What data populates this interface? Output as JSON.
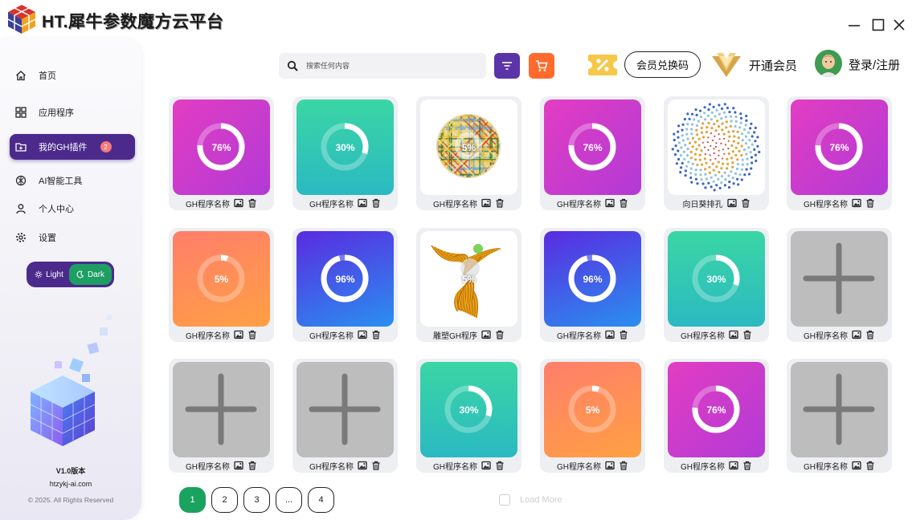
{
  "app": {
    "title": "HT.犀牛参数魔方云平台"
  },
  "sidebar": {
    "items": [
      {
        "label": "首页",
        "icon": "home-icon"
      },
      {
        "label": "应用程序",
        "icon": "apps-grid-icon"
      },
      {
        "label": "我的GH插件",
        "icon": "folder-plus-icon",
        "badge": "2"
      },
      {
        "label": "AI智能工具",
        "icon": "ai-knot-icon"
      },
      {
        "label": "个人中心",
        "icon": "user-icon"
      },
      {
        "label": "设置",
        "icon": "gear-icon"
      }
    ],
    "theme": {
      "light": "Light",
      "dark": "Dark",
      "selected": "Dark"
    },
    "version": "V1.0版本",
    "website": "htzykj-ai.com",
    "copyright": "© 2025. All Rights Reserved"
  },
  "topbar": {
    "search_placeholder": "搜索任何内容",
    "redeem_label": "会员兑换码",
    "vip_label": "开通会员",
    "login_label": "登录/注册"
  },
  "colors": {
    "accent": "#4b2a8c",
    "success": "#1aa35f",
    "cart": "#ff6b2c",
    "badge": "#f47a7a"
  },
  "cards": [
    {
      "name": "GH程序名称",
      "style": "mag",
      "progress": "76%",
      "ring": 0.76
    },
    {
      "name": "GH程序名称",
      "style": "teal",
      "progress": "30%",
      "ring": 0.3
    },
    {
      "name": "GH程序名称",
      "style": "sphere",
      "progress": "5%",
      "ring": 0.05
    },
    {
      "name": "GH程序名称",
      "style": "mag",
      "progress": "76%",
      "ring": 0.76
    },
    {
      "name": "向日葵排孔",
      "style": "dots",
      "progress": "",
      "ring": 0
    },
    {
      "name": "GH程序名称",
      "style": "mag",
      "progress": "76%",
      "ring": 0.76
    },
    {
      "name": "GH程序名称",
      "style": "orange",
      "progress": "5%",
      "ring": 0.05
    },
    {
      "name": "GH程序名称",
      "style": "blue",
      "progress": "96%",
      "ring": 0.96
    },
    {
      "name": "雕塑GH程序",
      "style": "sculpture",
      "progress": "5%",
      "ring": 0.05
    },
    {
      "name": "GH程序名称",
      "style": "blue",
      "progress": "96%",
      "ring": 0.96
    },
    {
      "name": "GH程序名称",
      "style": "teal",
      "progress": "30%",
      "ring": 0.3
    },
    {
      "name": "GH程序名称",
      "style": "add",
      "progress": "",
      "ring": 0
    },
    {
      "name": "GH程序名称",
      "style": "add",
      "progress": "",
      "ring": 0
    },
    {
      "name": "GH程序名称",
      "style": "add",
      "progress": "",
      "ring": 0
    },
    {
      "name": "GH程序名称",
      "style": "teal",
      "progress": "30%",
      "ring": 0.3
    },
    {
      "name": "GH程序名称",
      "style": "orange",
      "progress": "5%",
      "ring": 0.05
    },
    {
      "name": "GH程序名称",
      "style": "mag",
      "progress": "76%",
      "ring": 0.76
    },
    {
      "name": "GH程序名称",
      "style": "add",
      "progress": "",
      "ring": 0
    }
  ],
  "pagination": {
    "pages": [
      "1",
      "2",
      "3",
      "...",
      "4"
    ],
    "current": "1",
    "load_more": "Load More"
  }
}
